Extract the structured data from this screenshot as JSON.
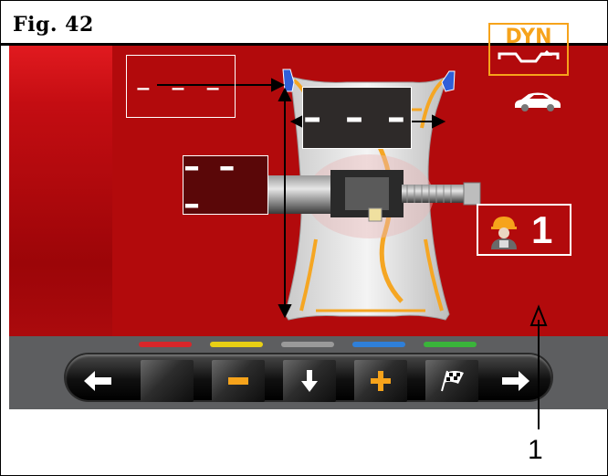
{
  "figure": {
    "label": "Fig.  42"
  },
  "display": {
    "upper_value": "– – –",
    "lower_value": "– – –",
    "width_value": "– – –",
    "program": "DYN",
    "operator_number": "1"
  },
  "colors": {
    "screen_red": "#b30a0d",
    "dyn_orange": "#f6a31b",
    "rim_orange": "#f5a623",
    "key_red": "#d8262a",
    "key_yellow": "#e8cf14",
    "key_gray": "#9a9a9a",
    "key_blue": "#2f7fd8",
    "key_green": "#3ab43a",
    "accent_yellow": "#f6a31b"
  },
  "keys": [
    {
      "icon": "arrow-left-icon",
      "color": "none"
    },
    {
      "icon": "blank-icon",
      "color": "red"
    },
    {
      "icon": "minus-icon",
      "color": "yellow"
    },
    {
      "icon": "arrow-down-icon",
      "color": "gray"
    },
    {
      "icon": "plus-icon",
      "color": "blue"
    },
    {
      "icon": "checkered-flag-icon",
      "color": "green"
    },
    {
      "icon": "arrow-right-icon",
      "color": "none"
    }
  ],
  "callout": {
    "number": "1"
  }
}
